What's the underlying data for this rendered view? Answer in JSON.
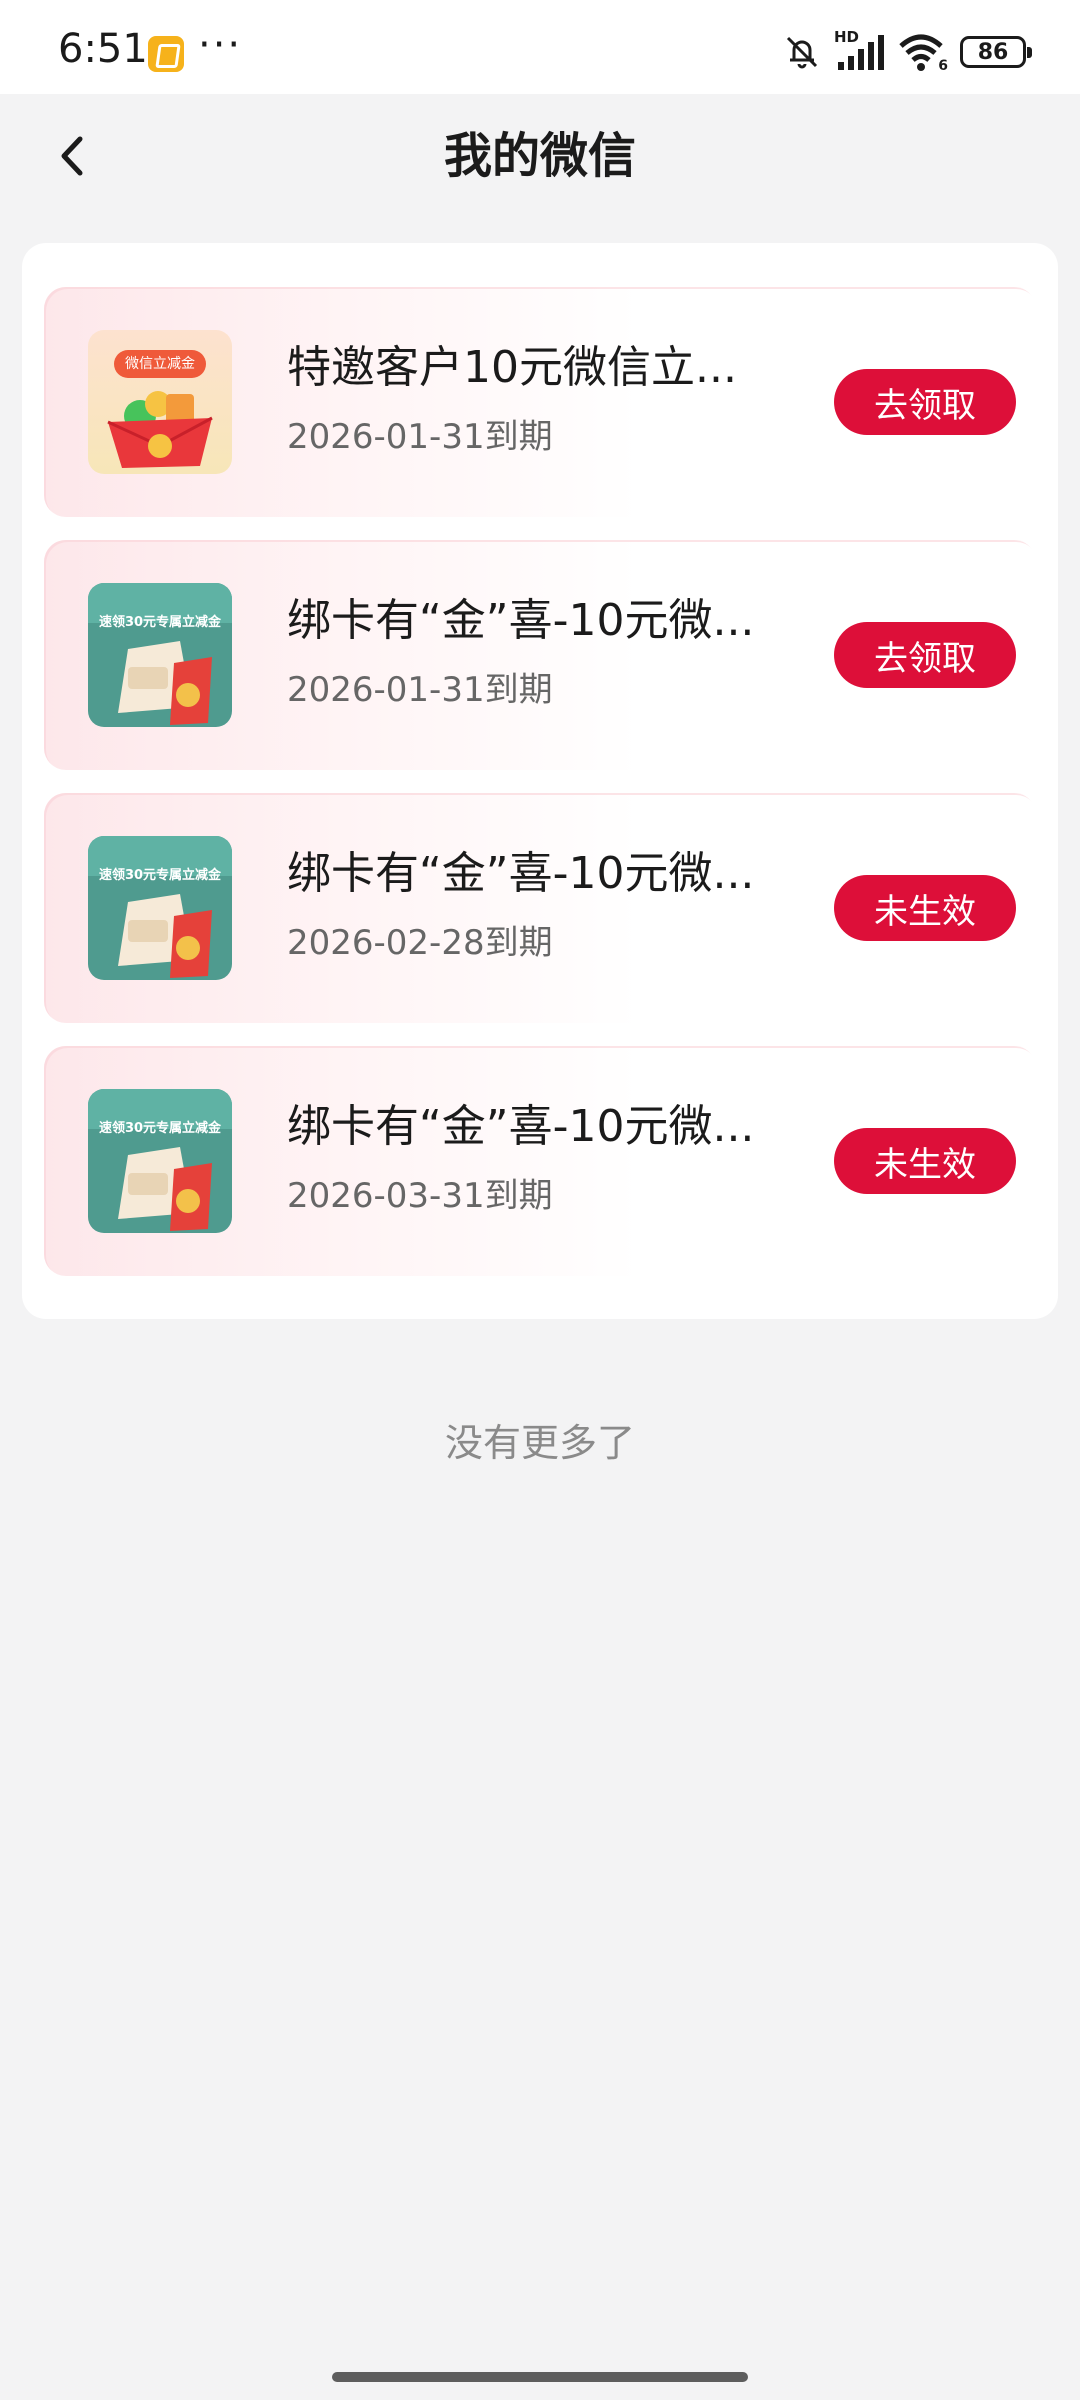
{
  "status_bar": {
    "time": "6:51",
    "more": "···",
    "battery": "86",
    "network": "HD",
    "wifi_badge": "6"
  },
  "nav": {
    "title": "我的微信"
  },
  "coupons": [
    {
      "title": "特邀客户10元微信立...",
      "expiry": "2026-01-31到期",
      "button": "去领取",
      "thumb_type": "wechat-red-envelope",
      "thumb_label": "微信立减金"
    },
    {
      "title": "绑卡有“金”喜-10元微...",
      "expiry": "2026-01-31到期",
      "button": "去领取",
      "thumb_type": "bank-voucher",
      "thumb_label": "速领30元专属立减金"
    },
    {
      "title": "绑卡有“金”喜-10元微...",
      "expiry": "2026-02-28到期",
      "button": "未生效",
      "thumb_type": "bank-voucher",
      "thumb_label": "速领30元专属立减金"
    },
    {
      "title": "绑卡有“金”喜-10元微...",
      "expiry": "2026-03-31到期",
      "button": "未生效",
      "thumb_type": "bank-voucher",
      "thumb_label": "速领30元专属立减金"
    }
  ],
  "footer": {
    "no_more": "没有更多了"
  },
  "colors": {
    "accent": "#dd0f39",
    "background": "#f3f3f4",
    "card": "#ffffff"
  }
}
